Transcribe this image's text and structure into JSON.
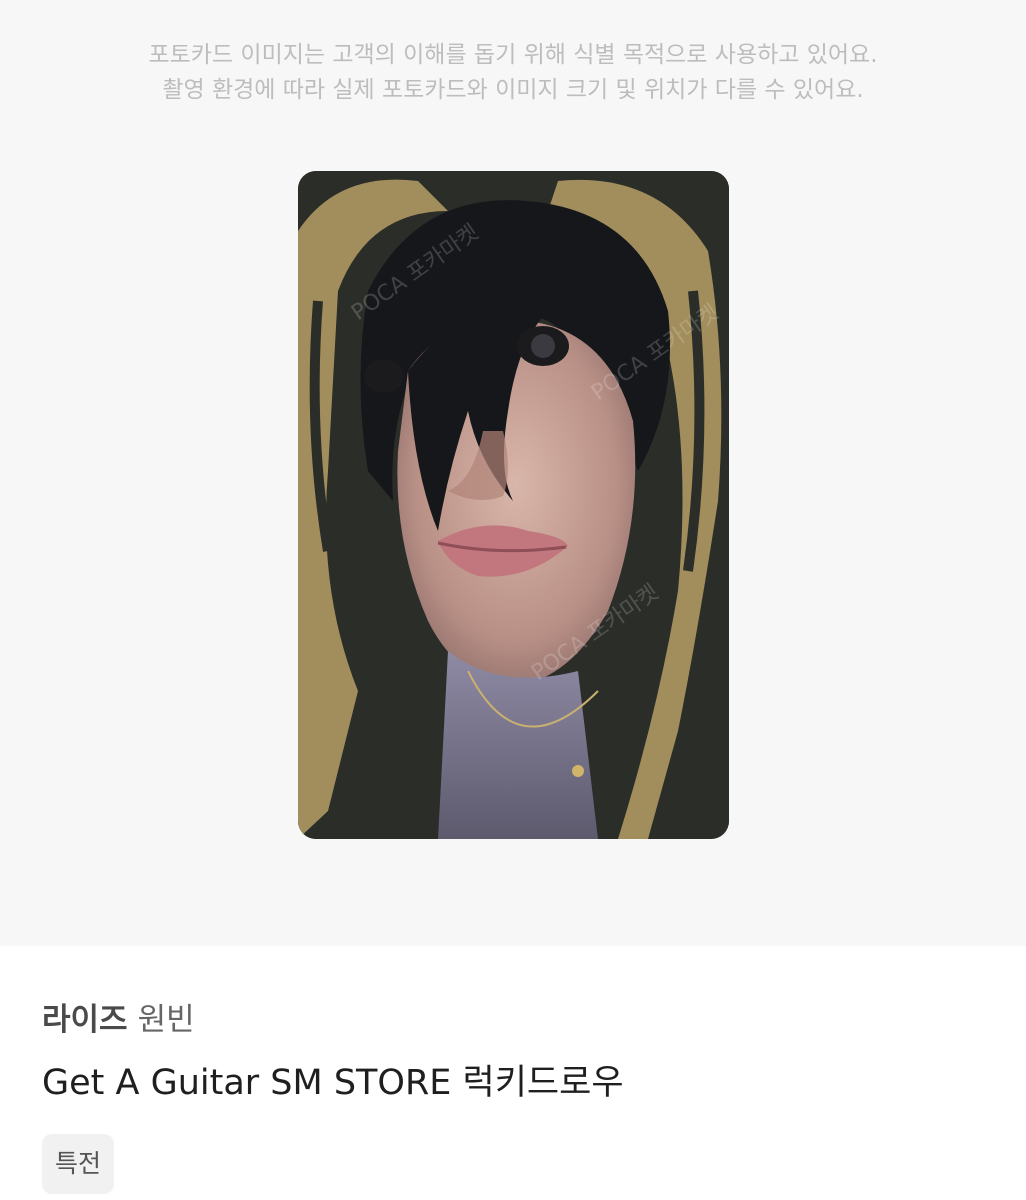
{
  "notice": {
    "line1": "포토카드 이미지는 고객의 이해를 돕기 위해 식별 목적으로 사용하고 있어요.",
    "line2": "촬영 환경에 따라 실제 포토카드와 이미지 크기 및 위치가 다를 수 있어요."
  },
  "photocard": {
    "watermark": "POCA 포카마켓",
    "colors": {
      "background": "#2b2d28",
      "hood_gold": "#b7a065",
      "hair": "#16171a",
      "skin": "#c79f93"
    }
  },
  "product": {
    "group": "라이즈",
    "member": "원빈",
    "title": "Get A Guitar SM STORE 럭키드로우",
    "badge": "특전"
  }
}
